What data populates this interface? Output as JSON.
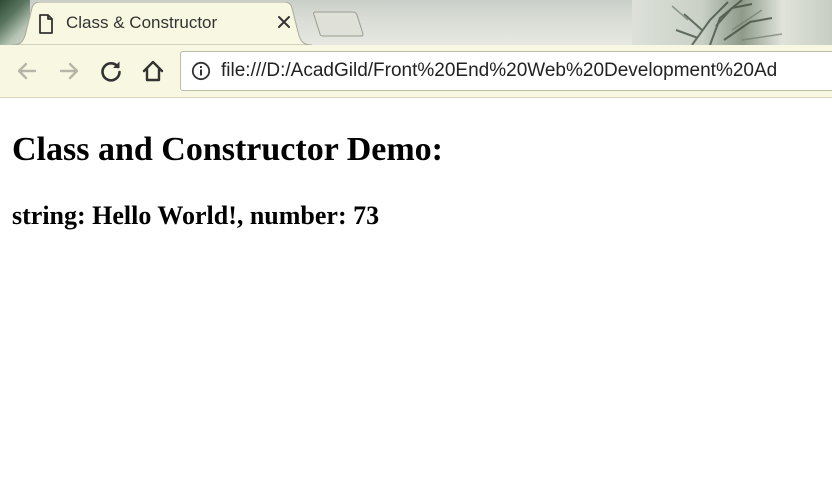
{
  "tab": {
    "title": "Class & Constructor",
    "icon": "page-icon",
    "close_icon": "close-icon"
  },
  "toolbar": {
    "icons": [
      "back-arrow-icon",
      "forward-arrow-icon",
      "reload-icon",
      "home-icon"
    ],
    "back_enabled": false,
    "forward_enabled": false
  },
  "omnibox": {
    "icon": "info-icon",
    "url": "file:///D:/AcadGild/Front%20End%20Web%20Development%20Ad"
  },
  "page": {
    "heading": "Class and Constructor Demo:",
    "output": "string: Hello World!, number: 73"
  },
  "colors": {
    "toolbar_background": "#f8f8e2",
    "tab_background": "#f8f8e2",
    "disabled_icon": "#b5b5a8",
    "icon": "#333333",
    "text": "#000000"
  }
}
